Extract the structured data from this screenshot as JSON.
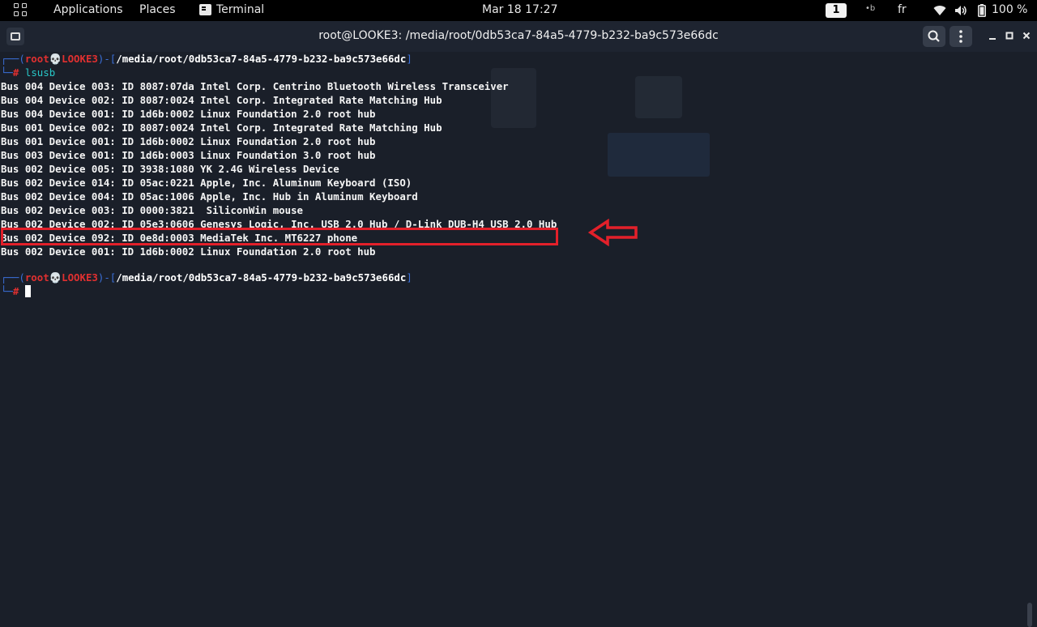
{
  "topbar": {
    "applications": "Applications",
    "places": "Places",
    "terminal": "Terminal",
    "clock": "Mar 18  17:27",
    "workspace": "1",
    "keyboard_layout": "fr",
    "battery": "100 %",
    "icons": [
      "activities-grid-icon",
      "terminal-app-icon",
      "accessibility-icon",
      "wifi-icon",
      "volume-icon",
      "battery-icon"
    ]
  },
  "window": {
    "title": "root@LOOKE3: /media/root/0db53ca7-84a5-4779-b232-ba9c573e66dc"
  },
  "prompt": {
    "open": "┌──(",
    "user": "root💀LOOKE3",
    "sep": ")-[",
    "path": "/media/root/0db53ca7-84a5-4779-b232-ba9c573e66dc",
    "close": "]",
    "corner": "└─",
    "hash": "#"
  },
  "command": "lsusb",
  "output": [
    "Bus 004 Device 003: ID 8087:07da Intel Corp. Centrino Bluetooth Wireless Transceiver",
    "Bus 004 Device 002: ID 8087:0024 Intel Corp. Integrated Rate Matching Hub",
    "Bus 004 Device 001: ID 1d6b:0002 Linux Foundation 2.0 root hub",
    "Bus 001 Device 002: ID 8087:0024 Intel Corp. Integrated Rate Matching Hub",
    "Bus 001 Device 001: ID 1d6b:0002 Linux Foundation 2.0 root hub",
    "Bus 003 Device 001: ID 1d6b:0003 Linux Foundation 3.0 root hub",
    "Bus 002 Device 005: ID 3938:1080 YK 2.4G Wireless Device",
    "Bus 002 Device 014: ID 05ac:0221 Apple, Inc. Aluminum Keyboard (ISO)",
    "Bus 002 Device 004: ID 05ac:1006 Apple, Inc. Hub in Aluminum Keyboard",
    "Bus 002 Device 003: ID 0000:3821  SiliconWin mouse",
    "Bus 002 Device 002: ID 05e3:0606 Genesys Logic, Inc. USB 2.0 Hub / D-Link DUB-H4 USB 2.0 Hub",
    "Bus 002 Device 092: ID 0e8d:0003 MediaTek Inc. MT6227 phone",
    "Bus 002 Device 001: ID 1d6b:0002 Linux Foundation 2.0 root hub"
  ],
  "colors": {
    "annotation": "#e3202a",
    "prompt_bracket": "#3b6fd8",
    "prompt_user": "#e03030",
    "command": "#28c8c8",
    "background": "#1a1f29"
  }
}
